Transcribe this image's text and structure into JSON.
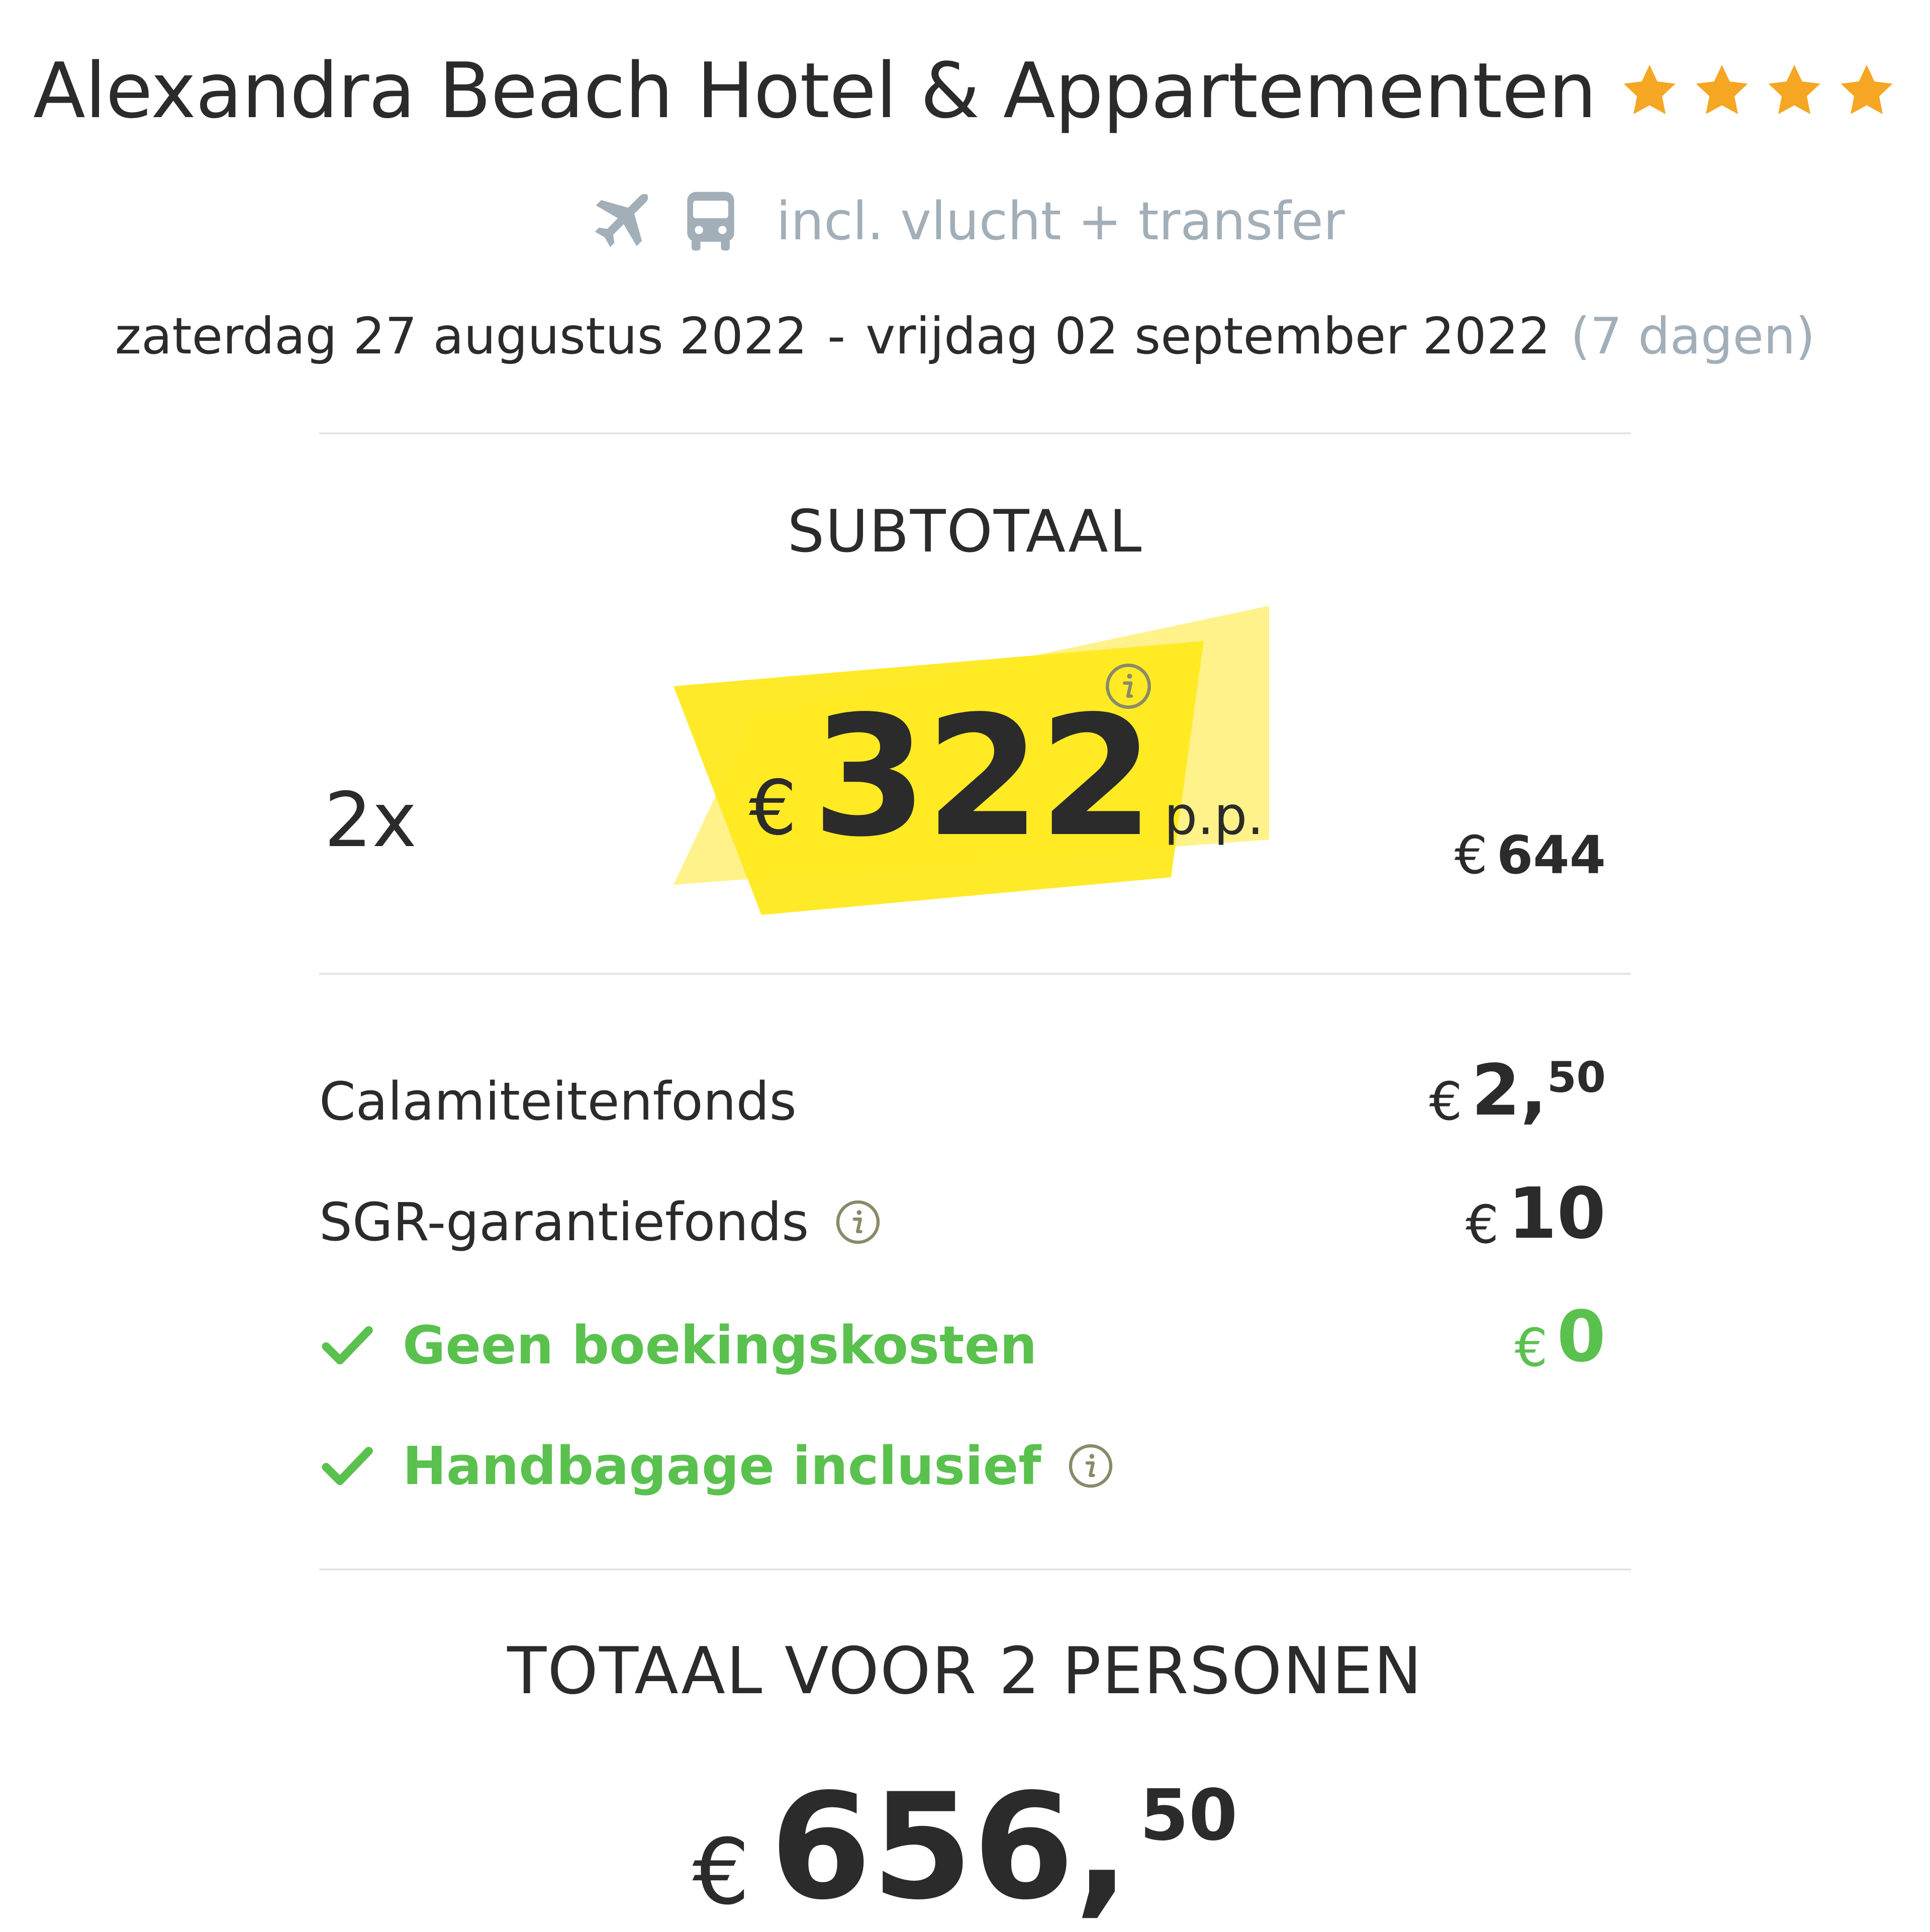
{
  "hotel": {
    "name": "Alexandra Beach Hotel & Appartementen",
    "star_rating": 4,
    "star_color": "#f5a623"
  },
  "transport": {
    "icons": [
      "airplane-icon",
      "bus-icon"
    ],
    "text": "incl. vlucht + transfer"
  },
  "dates": {
    "start": "zaterdag 27 augustus 2022",
    "separator": "-",
    "end": "vrijdag 02 september 2022",
    "duration": "(7 dagen)"
  },
  "subtotal": {
    "label": "SUBTOTAAL",
    "quantity": "2x",
    "currency": "€",
    "price_per_person": "322",
    "unit": "p.p.",
    "line_total_currency": "€",
    "line_total": "644",
    "highlight_color": "#ffe91f"
  },
  "costs": [
    {
      "label": "Calamiteitenfonds",
      "currency": "€",
      "amount": "2,",
      "decimals": "50"
    },
    {
      "label": "SGR-garantiefonds",
      "currency": "€",
      "amount": "10",
      "decimals": ""
    },
    {
      "label": "Geen boekingskosten",
      "currency": "€",
      "amount": "0",
      "decimals": ""
    }
  ],
  "inclusions": [
    {
      "label": "Handbagage inclusief"
    }
  ],
  "total": {
    "label": "TOTAAL VOOR 2 PERSONEN",
    "currency": "€",
    "amount": "656,",
    "decimals": "50"
  },
  "colors": {
    "accent_green": "#5ac14e",
    "muted_gray": "#a2aeb8",
    "text": "#2b2b2b"
  }
}
